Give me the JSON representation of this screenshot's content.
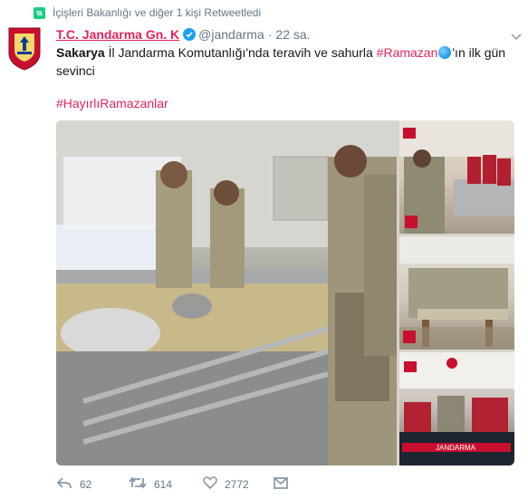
{
  "retweet": {
    "text": "İçişleri Bakanlığı ve diğer 1 kişi Retweetledi",
    "icon": "retweet-icon"
  },
  "tweet": {
    "author": "T.C. Jandarma Gn. K",
    "handle": "@jandarma",
    "separator": "·",
    "time": "22 sa.",
    "text_bold": "Sakarya",
    "text_part1": " İl Jandarma Komutanlığı'nda teravih ve sahurla ",
    "hashtag_ramazan": "#Ramazan",
    "text_part2": "'ın ilk gün sevinci",
    "hashtag_hayirli": "#HayırlıRamazanlar",
    "stamp_text": "JANDARMA"
  },
  "actions": {
    "reply_count": "62",
    "retweet_count": "614",
    "like_count": "2772"
  },
  "colors": {
    "accent": "#e0245e",
    "muted": "#657786",
    "verified": "#1da1f2",
    "retweet": "#19cf86"
  }
}
